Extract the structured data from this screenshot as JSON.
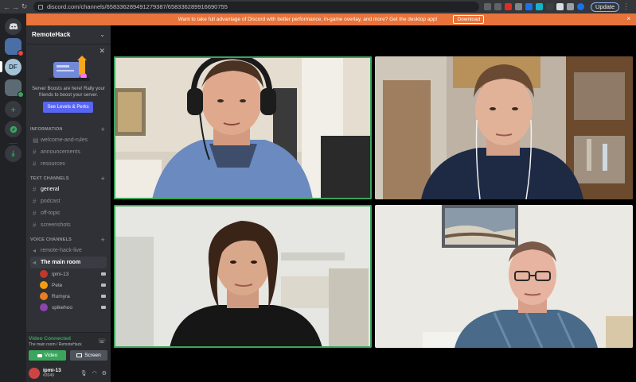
{
  "browser": {
    "url": "discord.com/channels/658336289491279387/658336289916690755",
    "update_label": "Update"
  },
  "banner": {
    "text": "Want to take full advantage of Discord with better performance, in-game overlay, and more? Get the desktop app!",
    "download_label": "Download",
    "close": "×"
  },
  "rail": {
    "server_initials": "DF"
  },
  "server": {
    "name": "RemoteHack",
    "boost": {
      "text": "Server Boosts are here! Rally your friends to boost your server.",
      "button": "See Levels & Perks"
    }
  },
  "categories": {
    "information": "INFORMATION",
    "text": "TEXT CHANNELS",
    "voice": "VOICE CHANNELS"
  },
  "information_channels": [
    {
      "name": "welcome-and-rules",
      "icon": "rules-icon"
    },
    {
      "name": "announcements",
      "icon": "hash-icon"
    },
    {
      "name": "resources",
      "icon": "hash-icon"
    }
  ],
  "text_channels": [
    {
      "name": "general",
      "active": true
    },
    {
      "name": "podcast"
    },
    {
      "name": "off-topic"
    },
    {
      "name": "screenshots"
    }
  ],
  "voice_channels": [
    {
      "name": "remote-hack-live"
    },
    {
      "name": "The main room",
      "selected": true
    }
  ],
  "voice_users": [
    {
      "name": "ipmi-13",
      "color": "#c0392b"
    },
    {
      "name": "Pete",
      "color": "#f39c12"
    },
    {
      "name": "Rumyra",
      "color": "#e67e22"
    },
    {
      "name": "spikehoo",
      "color": "#8e44ad"
    }
  ],
  "voice_panel": {
    "status": "Video Connected",
    "channel": "The main room / RemoteHack",
    "video_label": "Video",
    "screen_label": "Screen"
  },
  "me": {
    "name": "ipmi-13",
    "tag": "#2049"
  },
  "colors": {
    "accent": "#5865f2",
    "speaking": "#3ba55d",
    "banner": "#e8743b"
  }
}
